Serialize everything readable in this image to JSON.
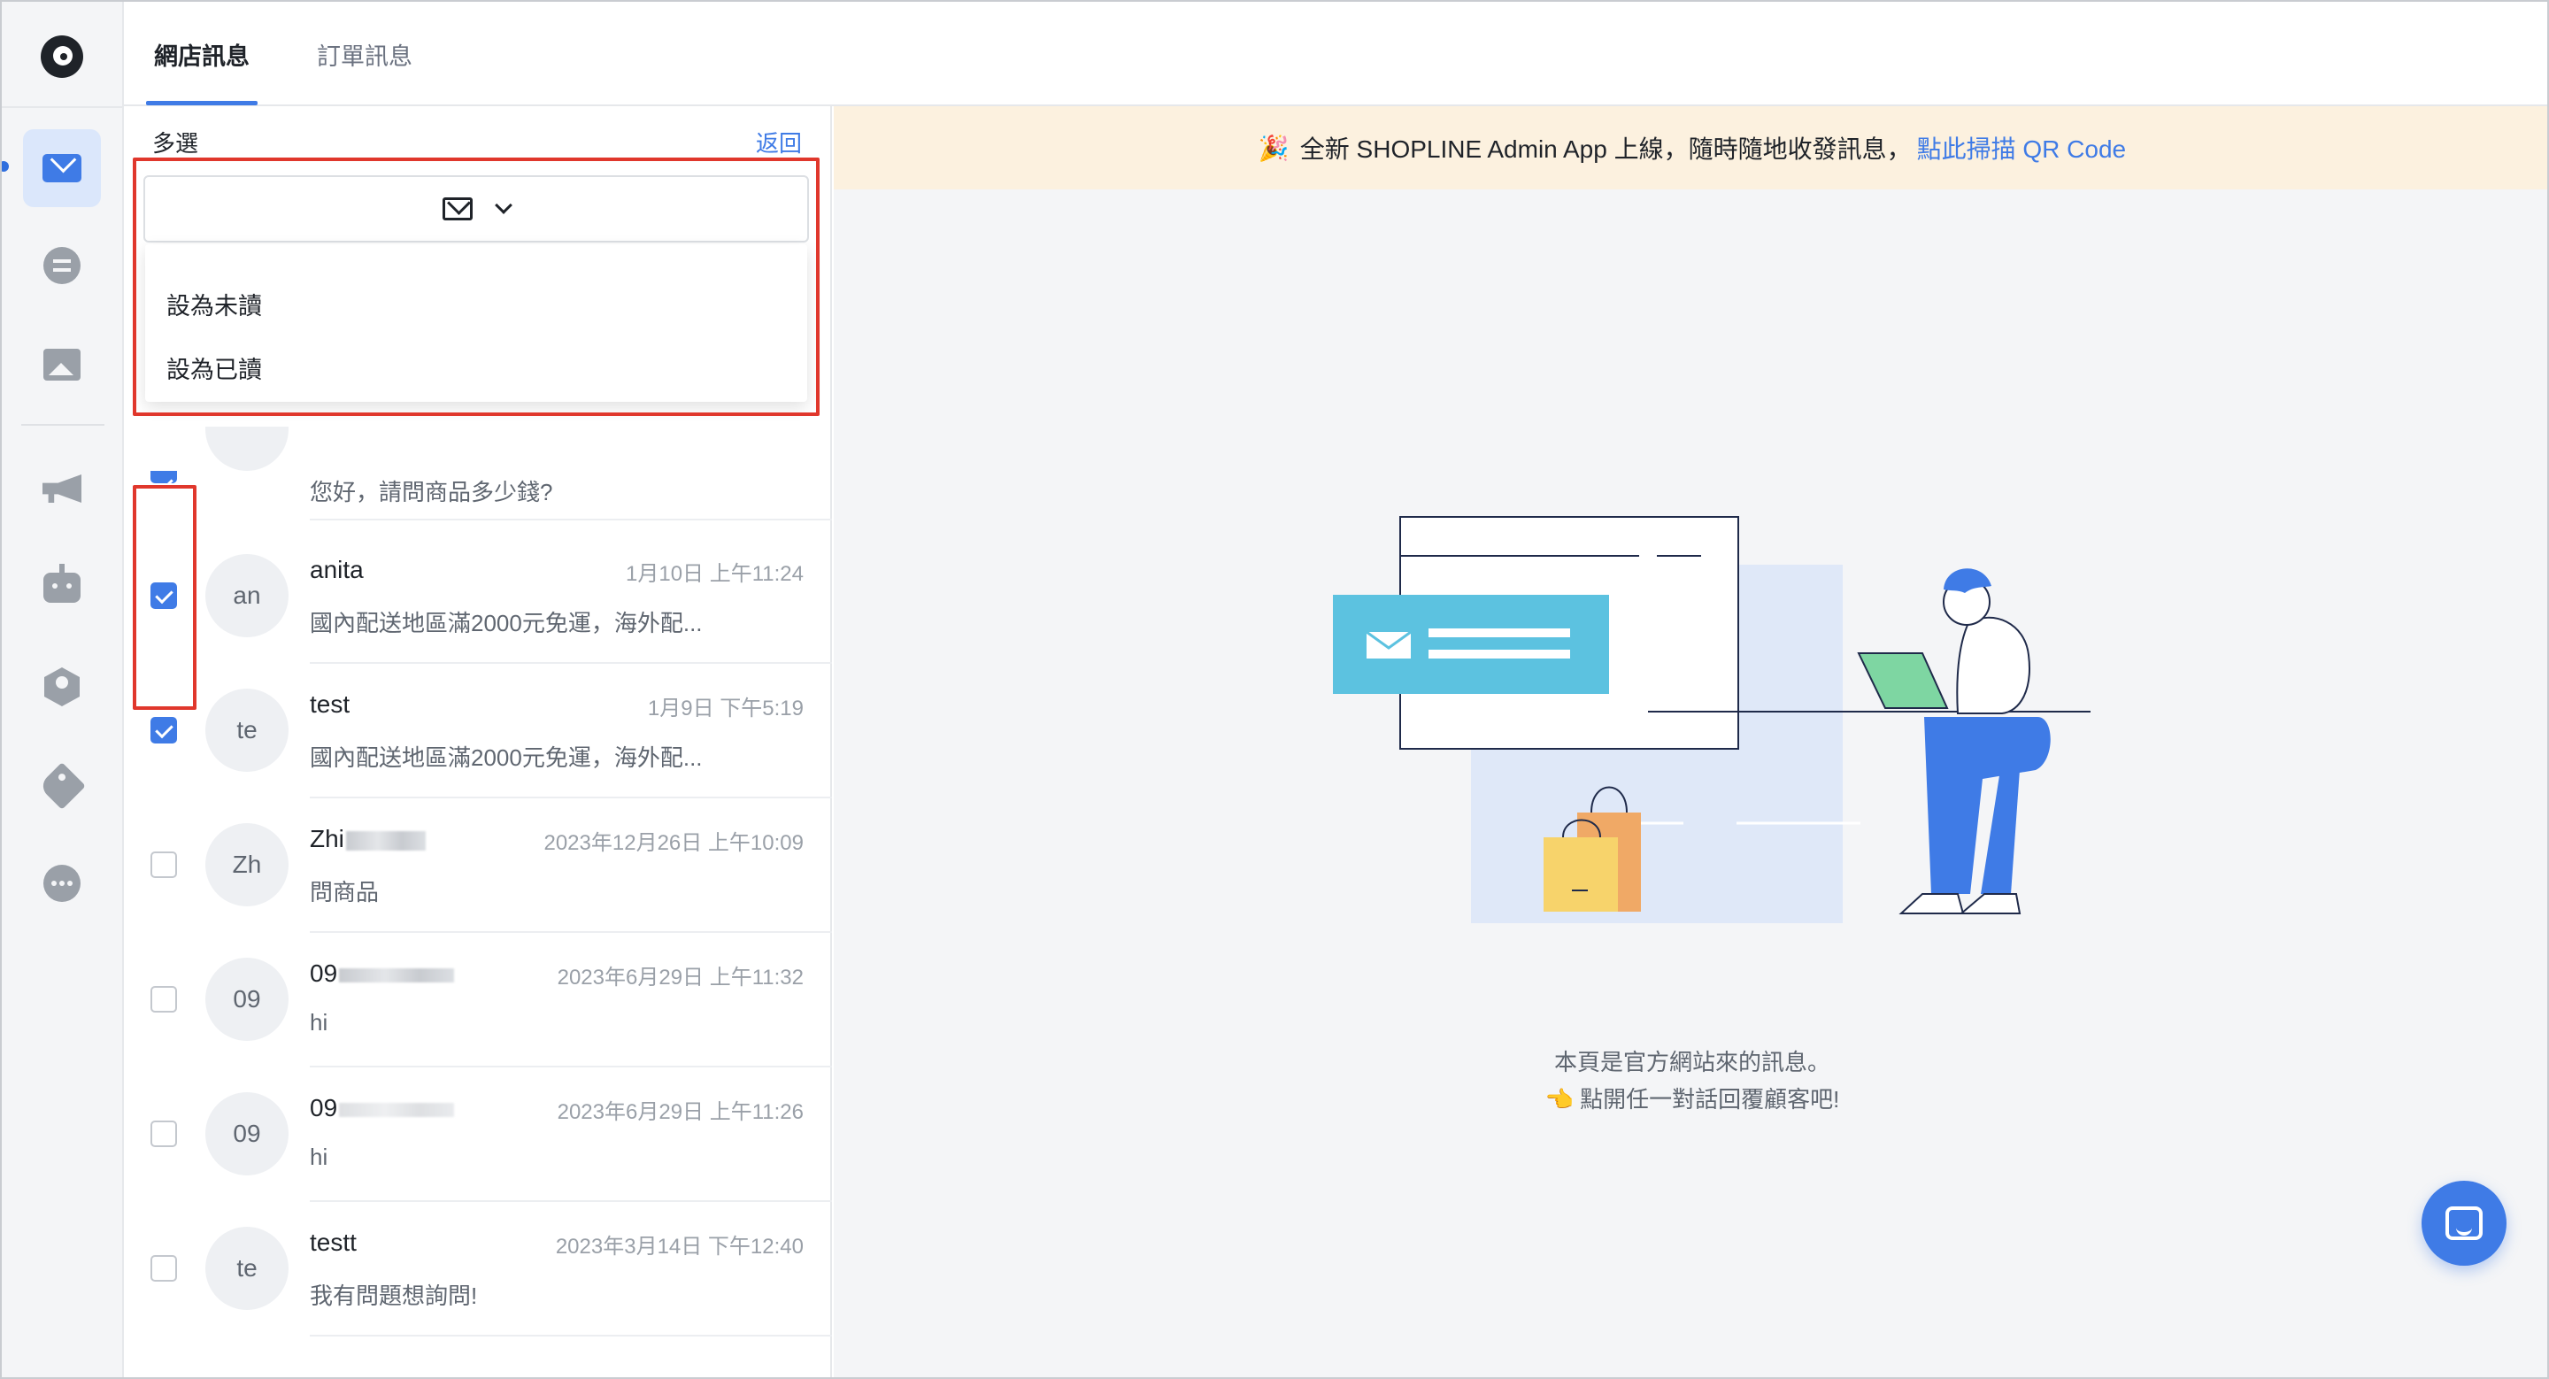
{
  "tabs": [
    {
      "label": "網店訊息",
      "active": true
    },
    {
      "label": "訂單訊息",
      "active": false
    }
  ],
  "list_header": {
    "multi_select_label": "多選",
    "back_label": "返回"
  },
  "dropdown": {
    "icon": "mail-icon",
    "options": [
      "設為未讀",
      "設為已讀"
    ]
  },
  "partial_row": {
    "snippet": "您好，請問商品多少錢?",
    "checked": true
  },
  "conversations": [
    {
      "avatar": "an",
      "name": "anita",
      "time": "1月10日 上午11:24",
      "snippet": "國內配送地區滿2000元免運，海外配...",
      "checked": true
    },
    {
      "avatar": "te",
      "name": "test",
      "time": "1月9日 下午5:19",
      "snippet": "國內配送地區滿2000元免運，海外配...",
      "checked": true
    },
    {
      "avatar": "Zh",
      "name": "Zhi",
      "time": "2023年12月26日 上午10:09",
      "snippet": "問商品",
      "checked": false
    },
    {
      "avatar": "09",
      "name": "09",
      "time": "2023年6月29日 上午11:32",
      "snippet": "hi",
      "checked": false
    },
    {
      "avatar": "09",
      "name": "09",
      "time": "2023年6月29日 上午11:26",
      "snippet": "hi",
      "checked": false
    },
    {
      "avatar": "te",
      "name": "testt",
      "time": "2023年3月14日 下午12:40",
      "snippet": "我有問題想詢問!",
      "checked": false
    }
  ],
  "banner": {
    "icon": "party-popper-icon",
    "text": "全新 SHOPLINE Admin App 上線，隨時隨地收發訊息，",
    "link": "點此掃描 QR Code"
  },
  "empty_state": {
    "line1": "本頁是官方網站來的訊息。",
    "line2": "👈 點開任一對話回覆顧客吧!"
  },
  "rail_icons": [
    "mail-icon",
    "chat-icon",
    "image-icon",
    "megaphone-icon",
    "bot-icon",
    "agent-icon",
    "tag-icon",
    "more-icon"
  ],
  "colors": {
    "accent": "#3f7be6",
    "highlight": "#e0372c",
    "banner_bg": "#fcf1df"
  }
}
